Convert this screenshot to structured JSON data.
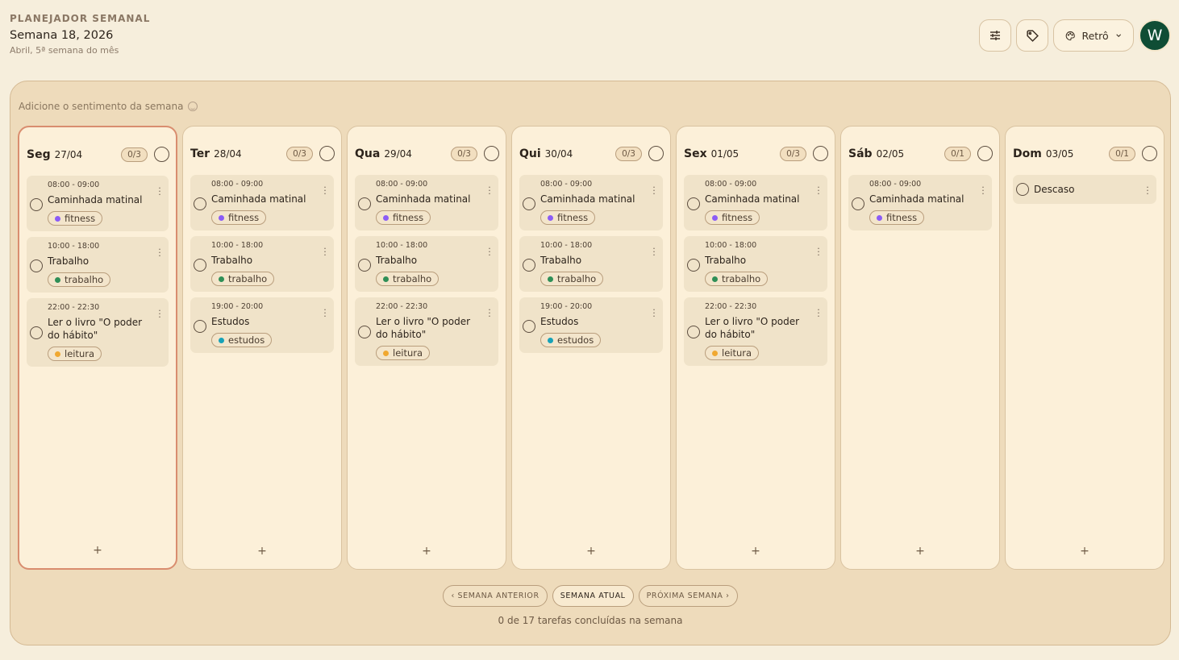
{
  "header": {
    "eyebrow": "PLANEJADOR SEMANAL",
    "title": "Semana 18, 2026",
    "subtitle": "Abril, 5ª semana do mês"
  },
  "toolbar": {
    "theme_label": "Retrô",
    "avatar_initial": "W"
  },
  "mood": {
    "label": "Adicione o sentimento da semana"
  },
  "tag_colors": {
    "fitness": "#8b5cf6",
    "trabalho": "#2f8f57",
    "leitura": "#f0a830",
    "estudos": "#17a2b8"
  },
  "days": [
    {
      "name": "Seg",
      "date": "27/04",
      "counter": "0/3",
      "today": true,
      "tasks": [
        {
          "time": "08:00 - 09:00",
          "title": "Caminhada matinal",
          "tag": "fitness"
        },
        {
          "time": "10:00 - 18:00",
          "title": "Trabalho",
          "tag": "trabalho"
        },
        {
          "time": "22:00 - 22:30",
          "title": "Ler o livro \"O poder do hábito\"",
          "tag": "leitura"
        }
      ]
    },
    {
      "name": "Ter",
      "date": "28/04",
      "counter": "0/3",
      "tasks": [
        {
          "time": "08:00 - 09:00",
          "title": "Caminhada matinal",
          "tag": "fitness"
        },
        {
          "time": "10:00 - 18:00",
          "title": "Trabalho",
          "tag": "trabalho"
        },
        {
          "time": "19:00 - 20:00",
          "title": "Estudos",
          "tag": "estudos"
        }
      ]
    },
    {
      "name": "Qua",
      "date": "29/04",
      "counter": "0/3",
      "tasks": [
        {
          "time": "08:00 - 09:00",
          "title": "Caminhada matinal",
          "tag": "fitness"
        },
        {
          "time": "10:00 - 18:00",
          "title": "Trabalho",
          "tag": "trabalho"
        },
        {
          "time": "22:00 - 22:30",
          "title": "Ler o livro \"O poder do hábito\"",
          "tag": "leitura"
        }
      ]
    },
    {
      "name": "Qui",
      "date": "30/04",
      "counter": "0/3",
      "tasks": [
        {
          "time": "08:00 - 09:00",
          "title": "Caminhada matinal",
          "tag": "fitness"
        },
        {
          "time": "10:00 - 18:00",
          "title": "Trabalho",
          "tag": "trabalho"
        },
        {
          "time": "19:00 - 20:00",
          "title": "Estudos",
          "tag": "estudos"
        }
      ]
    },
    {
      "name": "Sex",
      "date": "01/05",
      "counter": "0/3",
      "tasks": [
        {
          "time": "08:00 - 09:00",
          "title": "Caminhada matinal",
          "tag": "fitness"
        },
        {
          "time": "10:00 - 18:00",
          "title": "Trabalho",
          "tag": "trabalho"
        },
        {
          "time": "22:00 - 22:30",
          "title": "Ler o livro \"O poder do hábito\"",
          "tag": "leitura"
        }
      ]
    },
    {
      "name": "Sáb",
      "date": "02/05",
      "counter": "0/1",
      "tasks": [
        {
          "time": "08:00 - 09:00",
          "title": "Caminhada matinal",
          "tag": "fitness"
        }
      ]
    },
    {
      "name": "Dom",
      "date": "03/05",
      "counter": "0/1",
      "tasks": [
        {
          "time": "",
          "title": "Descaso",
          "tag": ""
        }
      ]
    }
  ],
  "add_label": "+",
  "nav": {
    "prev": "‹ SEMANA ANTERIOR",
    "current": "SEMANA ATUAL",
    "next": "PRÓXIMA SEMANA ›"
  },
  "summary": "0 de 17 tarefas concluídas na semana"
}
